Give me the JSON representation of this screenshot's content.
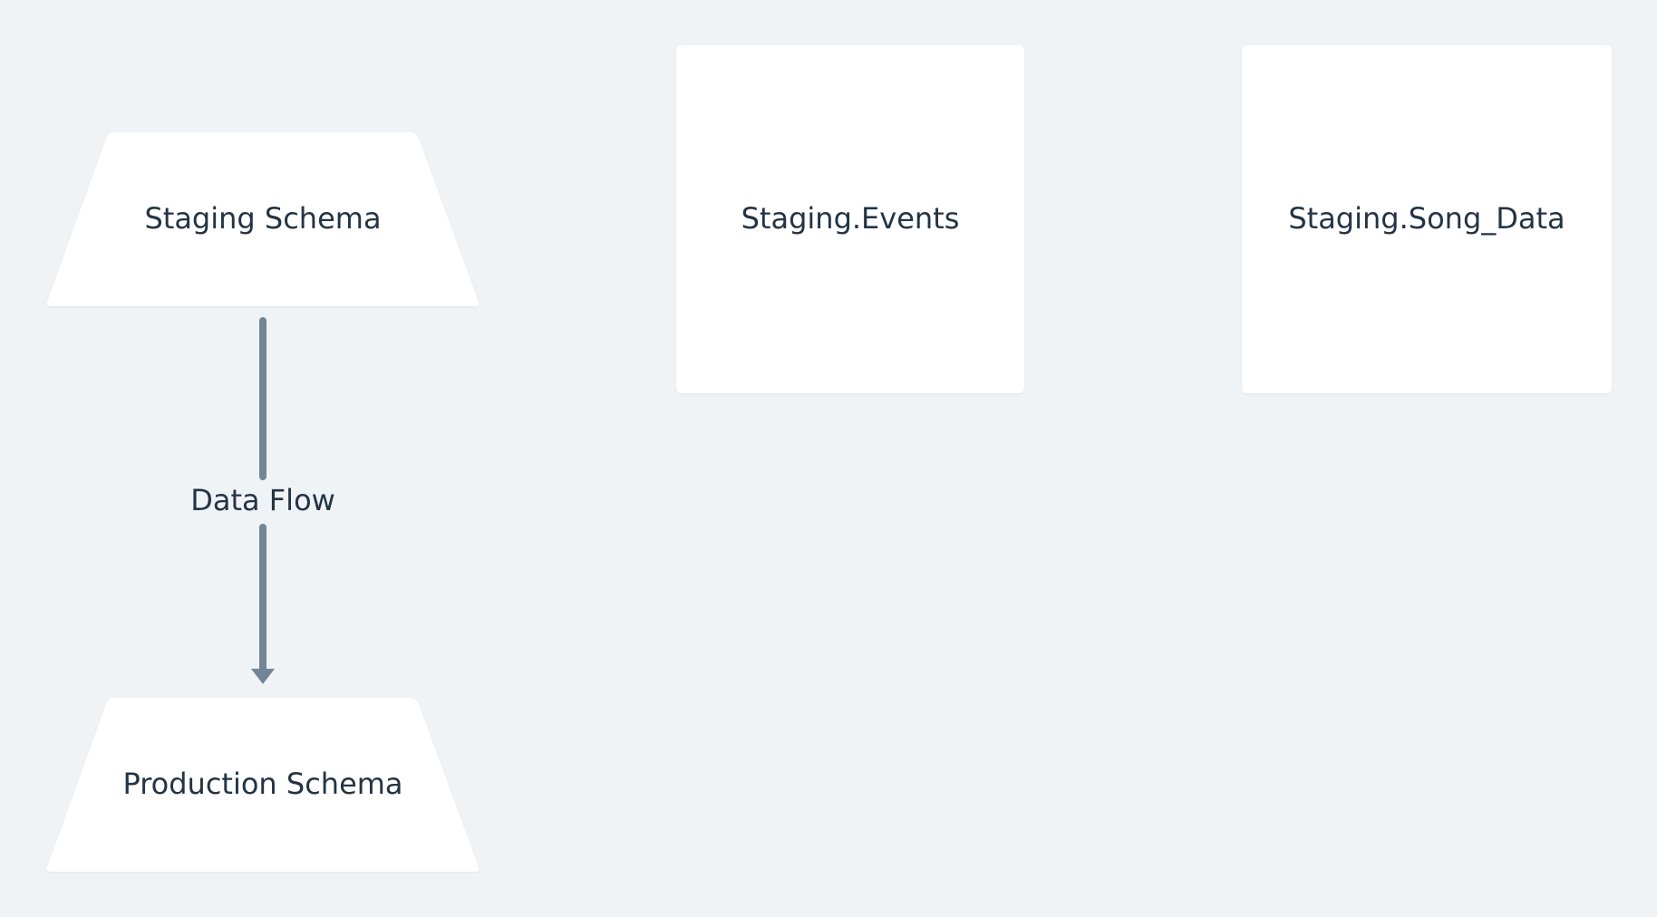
{
  "diagram": {
    "nodes": {
      "staging_schema": {
        "label": "Staging Schema",
        "shape": "trapezoid"
      },
      "production_schema": {
        "label": "Production Schema",
        "shape": "trapezoid"
      },
      "staging_events": {
        "label": "Staging.Events",
        "shape": "rectangle"
      },
      "staging_song_data": {
        "label": "Staging.Song_Data",
        "shape": "rectangle"
      }
    },
    "edges": [
      {
        "from": "staging_schema",
        "to": "production_schema",
        "label": "Data Flow"
      }
    ]
  },
  "colors": {
    "background": "#eff3f6",
    "node_fill": "#ffffff",
    "text": "#243444",
    "edge": "#748595"
  }
}
